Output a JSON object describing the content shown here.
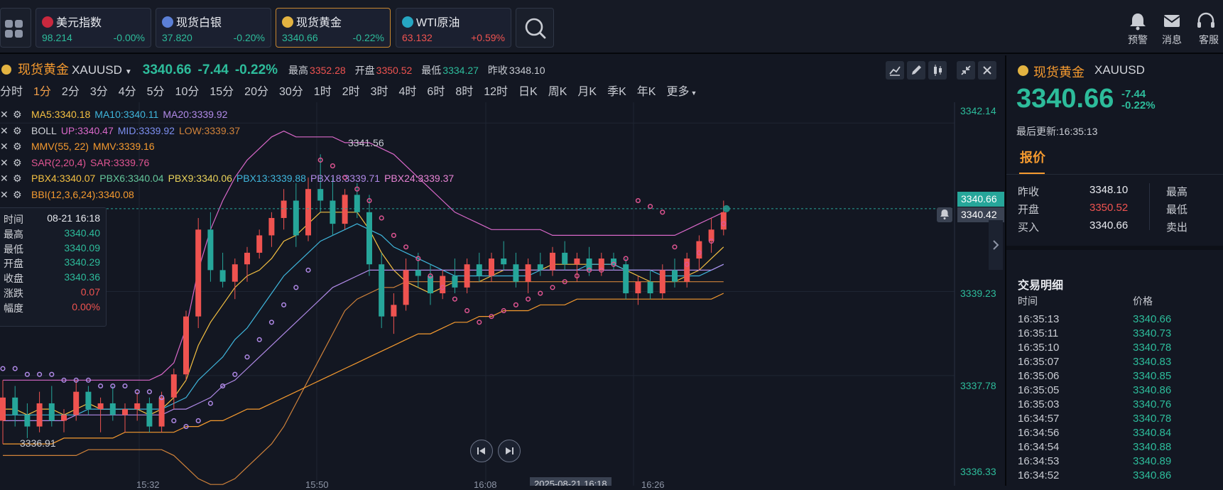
{
  "topbar": {
    "quotes": [
      {
        "name": "美元指数",
        "price": "98.214",
        "change": "-0.00%",
        "price_color": "#2dbc9b",
        "change_color": "#2dbc9b",
        "icon": "us-flag-icon",
        "icon_color": "#c9283e"
      },
      {
        "name": "现货白银",
        "price": "37.820",
        "change": "-0.20%",
        "price_color": "#2dbc9b",
        "change_color": "#2dbc9b",
        "icon": "silver-icon",
        "icon_color": "#5b7fd6"
      },
      {
        "name": "现货黄金",
        "price": "3340.66",
        "change": "-0.22%",
        "price_color": "#2dbc9b",
        "change_color": "#2dbc9b",
        "icon": "gold-icon",
        "icon_color": "#e3b341"
      },
      {
        "name": "WTI原油",
        "price": "63.132",
        "change": "+0.59%",
        "price_color": "#ef5350",
        "change_color": "#ef5350",
        "icon": "oil-icon",
        "icon_color": "#26a6c2"
      }
    ],
    "alert_label": "预警",
    "message_label": "消息",
    "service_label": "客服"
  },
  "chart_header": {
    "name": "现货黄金",
    "symbol": "XAUUSD",
    "price": "3340.66",
    "change": "-7.44",
    "change_pct": "-0.22%",
    "high_label": "最高",
    "high": "3352.28",
    "open_label": "开盘",
    "open": "3350.52",
    "low_label": "最低",
    "low": "3334.27",
    "prev_label": "昨收",
    "prev": "3348.10"
  },
  "periods": [
    "分时",
    "1分",
    "2分",
    "3分",
    "4分",
    "5分",
    "10分",
    "15分",
    "20分",
    "30分",
    "1时",
    "2时",
    "3时",
    "4时",
    "6时",
    "8时",
    "12时",
    "日K",
    "周K",
    "月K",
    "季K",
    "年K",
    "更多"
  ],
  "selected_period": "1分",
  "indicators": [
    {
      "parts": [
        {
          "t": "MA5:3340.18",
          "c": "#f4c042"
        },
        {
          "t": "MA10:3340.11",
          "c": "#3fb6dc"
        },
        {
          "t": "MA20:3339.92",
          "c": "#b18ae8"
        }
      ]
    },
    {
      "parts": [
        {
          "t": "BOLL",
          "c": "#d2d4da"
        },
        {
          "t": "UP:3340.47",
          "c": "#d968c9"
        },
        {
          "t": "MID:3339.92",
          "c": "#7d8ff0"
        },
        {
          "t": "LOW:3339.37",
          "c": "#d0823a"
        }
      ]
    },
    {
      "parts": [
        {
          "t": "MMV(55, 22)",
          "c": "#f59a2f"
        },
        {
          "t": "MMV:3339.16",
          "c": "#f59a2f"
        }
      ]
    },
    {
      "parts": [
        {
          "t": "SAR(2,20,4)",
          "c": "#e05592"
        },
        {
          "t": "SAR:3339.76",
          "c": "#e05592"
        }
      ]
    },
    {
      "parts": [
        {
          "t": "PBX4:3340.07",
          "c": "#f4c042"
        },
        {
          "t": "PBX6:3340.04",
          "c": "#64c79b"
        },
        {
          "t": "PBX9:3340.06",
          "c": "#e9d35a"
        },
        {
          "t": "PBX13:3339.88",
          "c": "#3fb6dc"
        },
        {
          "t": "PBX18:3339.71",
          "c": "#b18ae8"
        },
        {
          "t": "PBX24:3339.37",
          "c": "#e783d4"
        }
      ]
    },
    {
      "parts": [
        {
          "t": "BBI(12,3,6,24):3340.08",
          "c": "#f59a2f"
        }
      ]
    }
  ],
  "tooltip": {
    "rows": [
      {
        "k": "时间",
        "v": "08-21 16:18"
      },
      {
        "k": "最高",
        "v": "3340.40"
      },
      {
        "k": "最低",
        "v": "3340.09"
      },
      {
        "k": "开盘",
        "v": "3340.29"
      },
      {
        "k": "收盘",
        "v": "3340.36"
      },
      {
        "k": "涨跌",
        "v": "0.07"
      },
      {
        "k": "幅度",
        "v": "0.00%"
      }
    ]
  },
  "price_axis": {
    "ticks": [
      "3342.14",
      "3339.23",
      "3337.78",
      "3336.33"
    ],
    "current": "3340.66",
    "crosshair": "3340.42"
  },
  "chart_annotations": {
    "max_label": "3341.56",
    "min_label": "3336.91"
  },
  "time_axis": {
    "ticks": [
      "15:32",
      "15:50",
      "16:08",
      "16:26"
    ],
    "crosshair": "2025-08-21 16:18"
  },
  "chart_data": {
    "type": "candlestick",
    "ylim": [
      3336.0,
      3342.4
    ],
    "candles": [
      [
        3337.0,
        3337.7,
        3336.6,
        3337.4
      ],
      [
        3337.4,
        3337.6,
        3336.9,
        3337.1
      ],
      [
        3337.1,
        3337.3,
        3336.7,
        3336.9
      ],
      [
        3336.9,
        3337.5,
        3336.8,
        3337.3
      ],
      [
        3337.3,
        3337.6,
        3336.9,
        3337.0
      ],
      [
        3337.0,
        3337.2,
        3336.8,
        3337.1
      ],
      [
        3337.1,
        3337.7,
        3337.0,
        3337.5
      ],
      [
        3337.5,
        3337.6,
        3337.1,
        3337.2
      ],
      [
        3337.2,
        3337.4,
        3336.8,
        3337.3
      ],
      [
        3337.3,
        3337.6,
        3337.0,
        3337.1
      ],
      [
        3337.1,
        3337.3,
        3336.8,
        3337.2
      ],
      [
        3337.2,
        3337.5,
        3337.0,
        3337.3
      ],
      [
        3337.3,
        3337.4,
        3336.8,
        3336.9
      ],
      [
        3336.9,
        3337.5,
        3336.8,
        3337.4
      ],
      [
        3337.4,
        3337.9,
        3337.2,
        3337.8
      ],
      [
        3337.8,
        3338.9,
        3337.7,
        3338.8
      ],
      [
        3338.8,
        3340.5,
        3338.6,
        3340.3
      ],
      [
        3340.3,
        3340.6,
        3339.4,
        3339.6
      ],
      [
        3339.6,
        3339.9,
        3339.3,
        3339.4
      ],
      [
        3339.4,
        3339.8,
        3339.1,
        3339.7
      ],
      [
        3339.7,
        3340.0,
        3339.4,
        3339.9
      ],
      [
        3339.9,
        3340.3,
        3339.8,
        3340.2
      ],
      [
        3340.2,
        3340.6,
        3340.0,
        3340.5
      ],
      [
        3340.5,
        3341.0,
        3340.3,
        3340.8
      ],
      [
        3340.8,
        3341.1,
        3340.0,
        3340.2
      ],
      [
        3340.2,
        3341.2,
        3340.1,
        3341.0
      ],
      [
        3341.0,
        3341.6,
        3340.6,
        3340.8
      ],
      [
        3340.8,
        3341.2,
        3340.2,
        3340.4
      ],
      [
        3340.4,
        3341.0,
        3340.3,
        3340.9
      ],
      [
        3340.9,
        3341.1,
        3340.5,
        3340.6
      ],
      [
        3340.6,
        3340.9,
        3339.5,
        3339.7
      ],
      [
        3339.7,
        3339.9,
        3338.6,
        3338.8
      ],
      [
        3338.8,
        3339.2,
        3338.5,
        3339.0
      ],
      [
        3339.0,
        3339.8,
        3338.9,
        3339.6
      ],
      [
        3339.6,
        3339.9,
        3339.3,
        3339.5
      ],
      [
        3339.5,
        3339.7,
        3339.0,
        3339.2
      ],
      [
        3339.2,
        3339.6,
        3339.1,
        3339.5
      ],
      [
        3339.5,
        3339.8,
        3339.2,
        3339.3
      ],
      [
        3339.3,
        3339.8,
        3339.2,
        3339.7
      ],
      [
        3339.7,
        3339.9,
        3339.4,
        3339.5
      ],
      [
        3339.5,
        3339.9,
        3339.4,
        3339.8
      ],
      [
        3339.8,
        3340.1,
        3339.6,
        3339.7
      ],
      [
        3339.7,
        3339.9,
        3339.3,
        3339.4
      ],
      [
        3339.4,
        3339.8,
        3339.2,
        3339.7
      ],
      [
        3339.7,
        3339.9,
        3339.5,
        3339.6
      ],
      [
        3339.6,
        3340.0,
        3339.5,
        3339.9
      ],
      [
        3339.9,
        3340.1,
        3339.6,
        3339.7
      ],
      [
        3339.7,
        3339.9,
        3339.4,
        3339.8
      ],
      [
        3339.8,
        3340.0,
        3339.5,
        3339.6
      ],
      [
        3339.6,
        3339.9,
        3339.5,
        3339.8
      ],
      [
        3339.8,
        3339.9,
        3339.6,
        3339.7
      ],
      [
        3339.7,
        3339.8,
        3339.1,
        3339.2
      ],
      [
        3339.2,
        3339.5,
        3339.0,
        3339.4
      ],
      [
        3339.4,
        3339.6,
        3339.1,
        3339.2
      ],
      [
        3339.2,
        3339.7,
        3339.1,
        3339.6
      ],
      [
        3339.6,
        3339.8,
        3339.3,
        3339.4
      ],
      [
        3339.4,
        3339.9,
        3339.3,
        3339.8
      ],
      [
        3339.8,
        3340.2,
        3339.6,
        3340.1
      ],
      [
        3340.1,
        3340.5,
        3339.9,
        3340.3
      ],
      [
        3340.3,
        3340.8,
        3340.2,
        3340.6
      ]
    ],
    "series": [
      {
        "color": "#f4c042",
        "values": [
          3337.2,
          3337.2,
          3337.1,
          3337.2,
          3337.2,
          3337.1,
          3337.2,
          3337.3,
          3337.2,
          3337.2,
          3337.2,
          3337.2,
          3337.1,
          3337.2,
          3337.4,
          3337.7,
          3338.3,
          3338.7,
          3339.0,
          3339.3,
          3339.5,
          3339.6,
          3339.8,
          3340.1,
          3340.2,
          3340.4,
          3340.6,
          3340.6,
          3340.6,
          3340.6,
          3340.3,
          3339.9,
          3339.6,
          3339.4,
          3339.3,
          3339.2,
          3339.3,
          3339.4,
          3339.4,
          3339.4,
          3339.5,
          3339.6,
          3339.6,
          3339.6,
          3339.6,
          3339.7,
          3339.7,
          3339.7,
          3339.7,
          3339.7,
          3339.7,
          3339.6,
          3339.5,
          3339.4,
          3339.4,
          3339.4,
          3339.5,
          3339.6,
          3339.8,
          3340.0
        ]
      },
      {
        "color": "#3fb6dc",
        "values": [
          3337.1,
          3337.1,
          3337.1,
          3337.1,
          3337.1,
          3337.1,
          3337.1,
          3337.2,
          3337.2,
          3337.2,
          3337.2,
          3337.2,
          3337.2,
          3337.2,
          3337.3,
          3337.4,
          3337.7,
          3337.9,
          3338.1,
          3338.4,
          3338.6,
          3338.9,
          3339.2,
          3339.5,
          3339.7,
          3339.9,
          3340.1,
          3340.2,
          3340.3,
          3340.4,
          3340.3,
          3340.2,
          3340.0,
          3339.9,
          3339.8,
          3339.7,
          3339.6,
          3339.5,
          3339.5,
          3339.5,
          3339.5,
          3339.5,
          3339.5,
          3339.5,
          3339.6,
          3339.6,
          3339.6,
          3339.6,
          3339.7,
          3339.7,
          3339.7,
          3339.6,
          3339.6,
          3339.6,
          3339.5,
          3339.5,
          3339.5,
          3339.5,
          3339.6,
          3339.7
        ]
      },
      {
        "color": "#b18ae8",
        "values": [
          3337.0,
          3337.0,
          3337.0,
          3337.0,
          3337.0,
          3337.0,
          3337.1,
          3337.1,
          3337.1,
          3337.1,
          3337.1,
          3337.1,
          3337.1,
          3337.1,
          3337.2,
          3337.2,
          3337.3,
          3337.4,
          3337.6,
          3337.7,
          3337.9,
          3338.1,
          3338.3,
          3338.5,
          3338.7,
          3338.9,
          3339.1,
          3339.3,
          3339.4,
          3339.5,
          3339.6,
          3339.6,
          3339.6,
          3339.6,
          3339.6,
          3339.6,
          3339.6,
          3339.6,
          3339.6,
          3339.6,
          3339.6,
          3339.6,
          3339.6,
          3339.6,
          3339.6,
          3339.6,
          3339.6,
          3339.6,
          3339.6,
          3339.6,
          3339.6,
          3339.6,
          3339.6,
          3339.6,
          3339.6,
          3339.6,
          3339.6,
          3339.6,
          3339.6,
          3339.7
        ]
      },
      {
        "color": "#d968c9",
        "values": [
          3337.7,
          3337.7,
          3337.7,
          3337.7,
          3337.7,
          3337.7,
          3337.7,
          3337.7,
          3337.7,
          3337.7,
          3337.7,
          3337.7,
          3337.7,
          3337.8,
          3338.0,
          3338.6,
          3339.6,
          3340.3,
          3340.8,
          3341.2,
          3341.5,
          3341.7,
          3341.9,
          3342.0,
          3341.9,
          3341.9,
          3341.9,
          3341.9,
          3341.8,
          3341.8,
          3341.8,
          3341.7,
          3341.6,
          3341.4,
          3341.2,
          3341.0,
          3340.8,
          3340.6,
          3340.5,
          3340.4,
          3340.3,
          3340.3,
          3340.3,
          3340.3,
          3340.3,
          3340.2,
          3340.2,
          3340.2,
          3340.2,
          3340.2,
          3340.2,
          3340.2,
          3340.2,
          3340.2,
          3340.2,
          3340.2,
          3340.3,
          3340.4,
          3340.5,
          3340.6
        ]
      },
      {
        "color": "#d0823a",
        "values": [
          3336.4,
          3336.4,
          3336.4,
          3336.4,
          3336.4,
          3336.4,
          3336.4,
          3336.5,
          3336.5,
          3336.5,
          3336.5,
          3336.5,
          3336.5,
          3336.5,
          3336.4,
          3336.2,
          3336.0,
          3335.9,
          3335.9,
          3336.0,
          3336.2,
          3336.4,
          3336.6,
          3336.9,
          3337.3,
          3337.7,
          3338.1,
          3338.5,
          3338.9,
          3339.1,
          3339.2,
          3339.3,
          3339.3,
          3339.4,
          3339.4,
          3339.4,
          3339.4,
          3339.4,
          3339.4,
          3339.4,
          3339.4,
          3339.4,
          3339.4,
          3339.4,
          3339.4,
          3339.4,
          3339.4,
          3339.4,
          3339.4,
          3339.4,
          3339.4,
          3339.4,
          3339.4,
          3339.4,
          3339.4,
          3339.4,
          3339.4,
          3339.4,
          3339.4,
          3339.4
        ]
      },
      {
        "color": "#f59a2f",
        "values": [
          3336.6,
          3336.6,
          3336.6,
          3336.6,
          3336.6,
          3336.7,
          3336.7,
          3336.7,
          3336.7,
          3336.7,
          3336.8,
          3336.8,
          3336.8,
          3336.8,
          3336.8,
          3336.9,
          3336.9,
          3337.0,
          3337.0,
          3337.1,
          3337.2,
          3337.2,
          3337.3,
          3337.4,
          3337.5,
          3337.6,
          3337.7,
          3337.8,
          3337.9,
          3338.0,
          3338.1,
          3338.2,
          3338.3,
          3338.4,
          3338.5,
          3338.5,
          3338.6,
          3338.7,
          3338.7,
          3338.8,
          3338.8,
          3338.9,
          3338.9,
          3338.9,
          3339.0,
          3339.0,
          3339.0,
          3339.1,
          3339.1,
          3339.1,
          3339.1,
          3339.1,
          3339.1,
          3339.1,
          3339.1,
          3339.1,
          3339.1,
          3339.1,
          3339.1,
          3339.2
        ]
      }
    ],
    "sar": [
      3337.9,
      3337.9,
      3337.8,
      3337.8,
      3337.8,
      3337.7,
      3337.7,
      3337.7,
      3337.6,
      3337.6,
      3337.6,
      3337.5,
      3337.5,
      3337.4,
      3337.0,
      3336.9,
      3337.0,
      3337.3,
      3337.6,
      3337.8,
      3338.1,
      3338.4,
      3338.7,
      3339.0,
      3339.3,
      3339.6,
      3341.5,
      3341.4,
      3341.2,
      3341.0,
      3340.8,
      3340.5,
      3340.2,
      3340.0,
      3339.8,
      3339.5,
      3339.3,
      3339.1,
      3338.9,
      3338.7,
      3338.8,
      3338.9,
      3339.0,
      3339.1,
      3339.2,
      3339.3,
      3339.4,
      3339.5,
      3339.6,
      3339.6,
      3339.7,
      3339.8,
      3340.8,
      3340.7,
      3340.6,
      3340.0,
      3339.7,
      3339.9,
      3340.1,
      3340.4
    ]
  },
  "right_panel": {
    "name": "现货黄金",
    "symbol": "XAUUSD",
    "price": "3340.66",
    "change": "-7.44",
    "change_pct": "-0.22%",
    "update_label": "最后更新:16:35:13",
    "quote_tab": "报价",
    "grid": [
      {
        "k": "昨收",
        "v": "3348.10",
        "vc": "#e8eaef",
        "k2": "最高"
      },
      {
        "k": "开盘",
        "v": "3350.52",
        "vc": "#ef5350",
        "k2": "最低"
      },
      {
        "k": "买入",
        "v": "3340.66",
        "vc": "#e8eaef",
        "k2": "卖出"
      }
    ],
    "trades_title": "交易明细",
    "col_time": "时间",
    "col_price": "价格",
    "trades": [
      {
        "t": "16:35:13",
        "p": "3340.66"
      },
      {
        "t": "16:35:11",
        "p": "3340.73"
      },
      {
        "t": "16:35:10",
        "p": "3340.78"
      },
      {
        "t": "16:35:07",
        "p": "3340.83"
      },
      {
        "t": "16:35:06",
        "p": "3340.85"
      },
      {
        "t": "16:35:05",
        "p": "3340.86"
      },
      {
        "t": "16:35:03",
        "p": "3340.76"
      },
      {
        "t": "16:34:57",
        "p": "3340.78"
      },
      {
        "t": "16:34:56",
        "p": "3340.84"
      },
      {
        "t": "16:34:54",
        "p": "3340.88"
      },
      {
        "t": "16:34:53",
        "p": "3340.89"
      },
      {
        "t": "16:34:52",
        "p": "3340.86"
      }
    ]
  }
}
